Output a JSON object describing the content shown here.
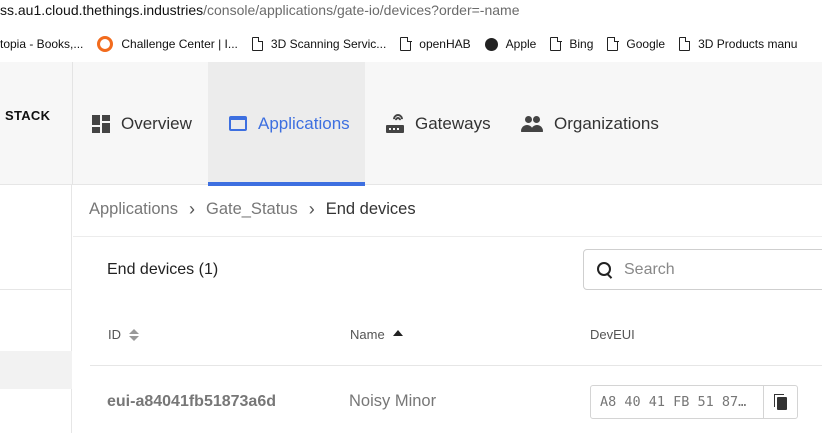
{
  "browser": {
    "url_host": "ss.au1.cloud.thethings.industries",
    "url_path": "/console/applications/gate-io/devices?order=-name",
    "bookmarks": [
      {
        "label": "topia - Books,...",
        "icon": "none"
      },
      {
        "label": "Challenge Center | I...",
        "icon": "orange-ring-icon"
      },
      {
        "label": "3D Scanning Servic...",
        "icon": "page-icon"
      },
      {
        "label": "openHAB",
        "icon": "page-icon"
      },
      {
        "label": "Apple",
        "icon": "apple-icon"
      },
      {
        "label": "Bing",
        "icon": "page-icon"
      },
      {
        "label": "Google",
        "icon": "page-icon"
      },
      {
        "label": "3D Products manu",
        "icon": "page-icon"
      }
    ]
  },
  "nav": {
    "brand": "STACK",
    "tabs": [
      {
        "label": "Overview",
        "icon": "dashboard-grid-icon",
        "active": false
      },
      {
        "label": "Applications",
        "icon": "application-window-icon",
        "active": true
      },
      {
        "label": "Gateways",
        "icon": "gateway-router-icon",
        "active": false
      },
      {
        "label": "Organizations",
        "icon": "people-group-icon",
        "active": false
      }
    ],
    "accent_color": "#3d6fe0"
  },
  "breadcrumb": {
    "items": [
      "Applications",
      "Gate_Status",
      "End devices"
    ],
    "separator": "›"
  },
  "devices": {
    "title": "End devices (1)",
    "search_placeholder": "Search",
    "columns": {
      "id": "ID",
      "name": "Name",
      "dev_eui": "DevEUI"
    },
    "sort": {
      "id": "unsorted",
      "name": "ascending"
    },
    "rows": [
      {
        "id": "eui-a84041fb51873a6d",
        "name": "Noisy Minor",
        "dev_eui": "A8 40 41 FB 51 87…"
      }
    ]
  }
}
